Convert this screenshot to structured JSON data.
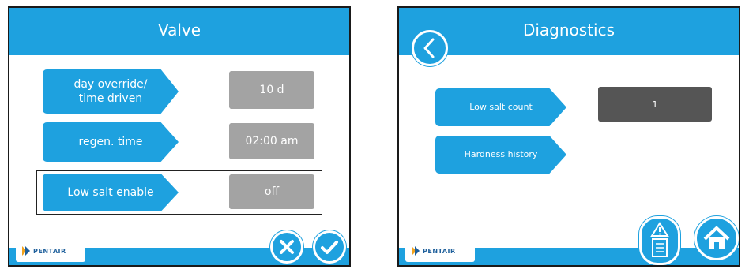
{
  "valve": {
    "title": "Valve",
    "rows": [
      {
        "label_line1": "day override/",
        "label_line2": "time driven",
        "value": "10 d"
      },
      {
        "label": "regen. time",
        "value": "02:00 am"
      },
      {
        "label": "Low salt enable",
        "value": "off"
      }
    ],
    "logo": "PENTAIR"
  },
  "diagnostics": {
    "title": "Diagnostics",
    "rows": [
      {
        "label": "Low salt count",
        "value": "1"
      },
      {
        "label": "Hardness history"
      }
    ],
    "logo": "PENTAIR"
  },
  "icons": [
    "back-arrow-icon",
    "cancel-x-icon",
    "confirm-check-icon",
    "warning-clipboard-icon",
    "home-icon"
  ],
  "colors": {
    "accent": "#1ea1df",
    "value_bg": "#a3a3a3",
    "value_dark_bg": "#555555"
  }
}
